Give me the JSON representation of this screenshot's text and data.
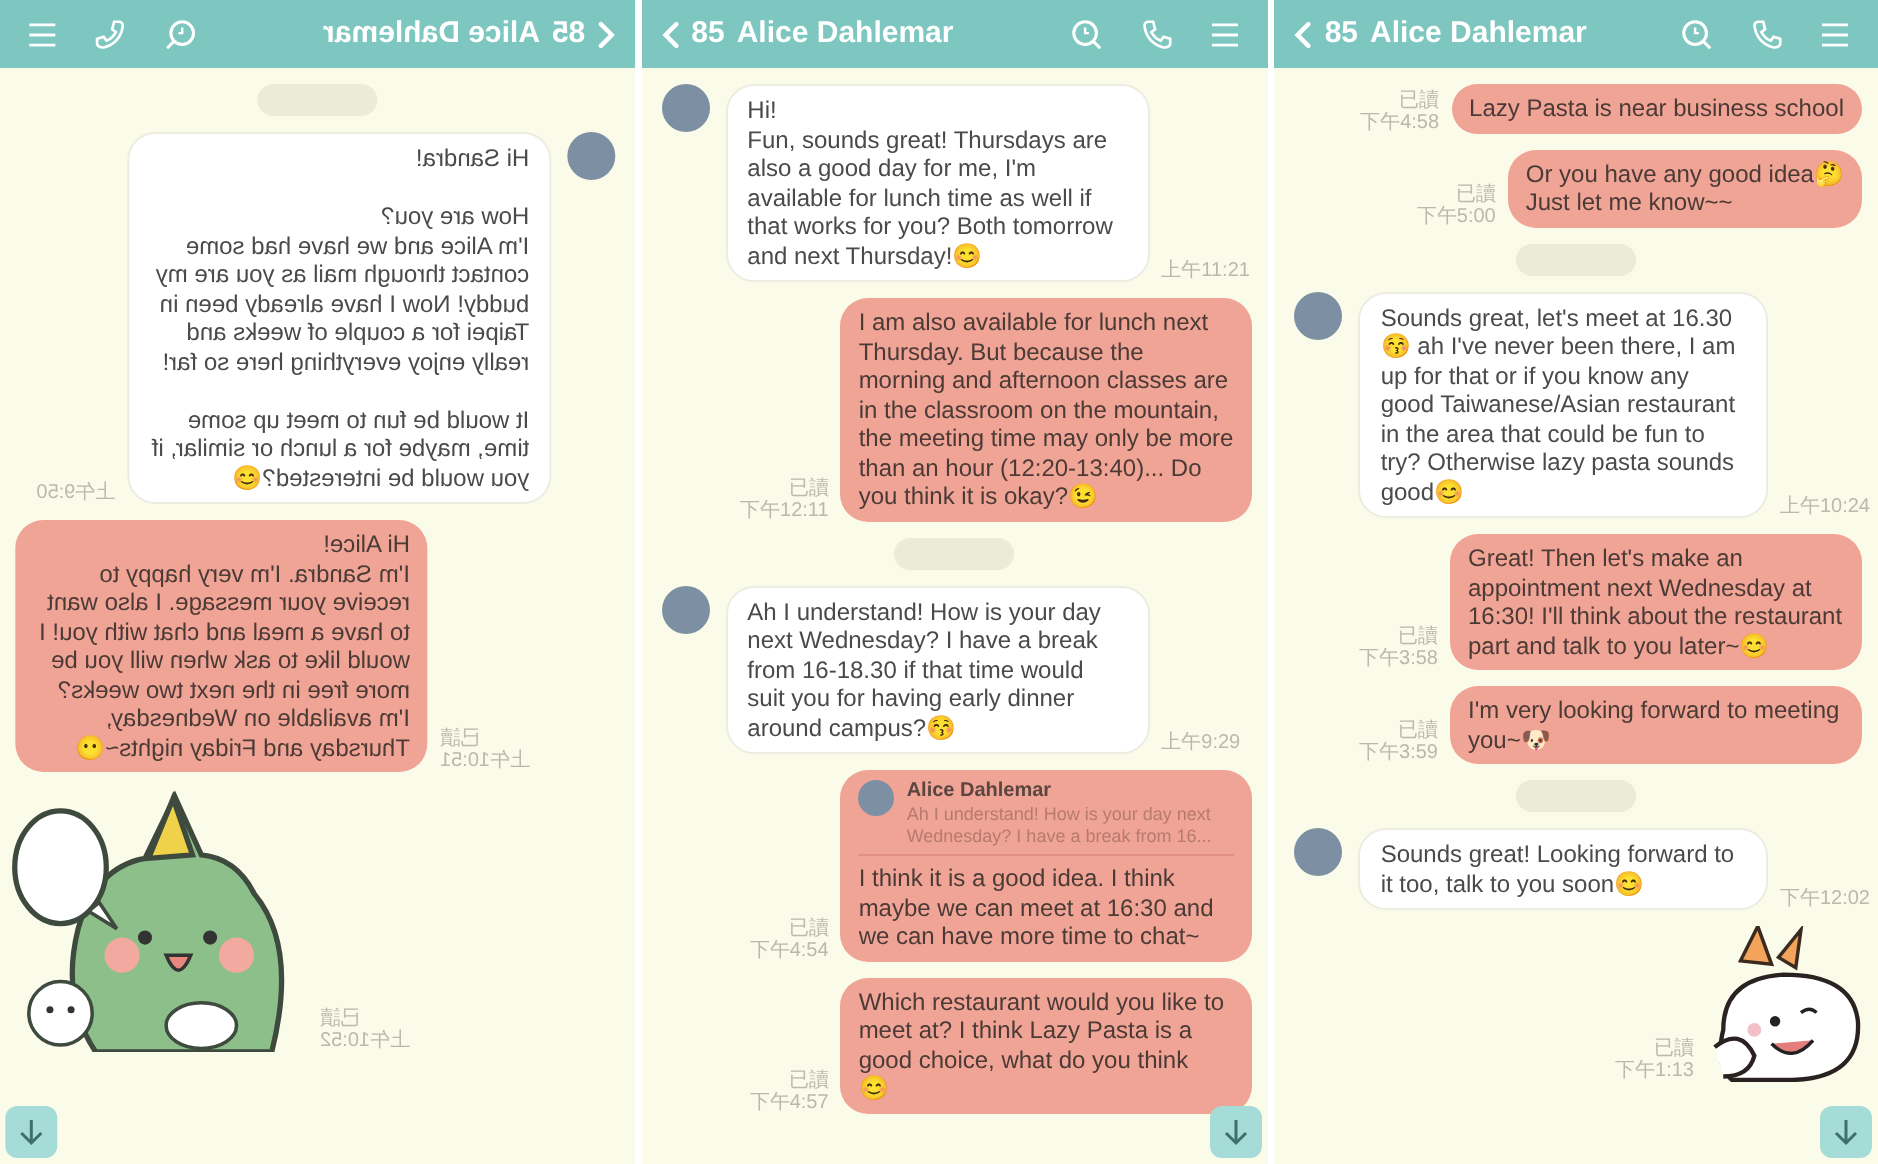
{
  "panels": [
    {
      "mirrored": true,
      "header": {
        "count": "85",
        "title": "Alice Dahlemar"
      },
      "items": [
        {
          "kind": "date"
        },
        {
          "kind": "received",
          "time": "上午9:50",
          "text": "Hi Sandra!\n\nHow are you?\nI'm Alice and we have had some contact through mail as you are my buddy! Now I have already been in Taipei for a couple of weeks and really enjoy everything here so far!\n\nIt would be fun to meet up some time, maybe for a lunch or similar, if you would be interested?😊"
        },
        {
          "kind": "sent",
          "read": "已讀",
          "time": "上午10:51",
          "text": "Hi Alice!\nI'm Sandra. I'm very happy to receive your message. I also want to have a meal and chat with you! I would like to ask when will you be more free in the next two weeks? I'm available on Wednesday, Thursday and Friday nights~😶"
        },
        {
          "kind": "sticker",
          "read": "已讀",
          "time": "上午10:52"
        }
      ]
    },
    {
      "mirrored": false,
      "header": {
        "count": "85",
        "title": "Alice Dahlemar"
      },
      "items": [
        {
          "kind": "received",
          "time": "上午11:21",
          "text": "Hi!\nFun, sounds great! Thursdays are also a good day for me, I'm available for lunch time as well if that works for you? Both tomorrow and next Thursday!😊"
        },
        {
          "kind": "sent",
          "read": "已讀",
          "time": "下午12:11",
          "text": "I am also available for lunch next Thursday. But because the morning and afternoon classes are in the classroom on the mountain, the meeting time may only be more than an hour (12:20-13:40)... Do you think it is okay?😉"
        },
        {
          "kind": "date"
        },
        {
          "kind": "received",
          "time": "上午9:29",
          "text": "Ah I understand! How is your day next Wednesday? I have a break from 16-18.30 if that time would suit you for having early dinner around campus?😚"
        },
        {
          "kind": "sent",
          "read": "已讀",
          "time": "下午4:54",
          "quote": {
            "name": "Alice Dahlemar",
            "text": "Ah I understand! How is your day next Wednesday? I have a break from 16..."
          },
          "text": "I think it is a good idea. I think maybe we can meet at 16:30 and we can have more time to chat~"
        },
        {
          "kind": "sent",
          "read": "已讀",
          "time": "下午4:57",
          "text": "Which restaurant would you like to meet at? I think Lazy Pasta is a good choice, what do you think\n😊"
        }
      ]
    },
    {
      "mirrored": false,
      "header": {
        "count": "85",
        "title": "Alice Dahlemar"
      },
      "items": [
        {
          "kind": "sent",
          "read": "已讀",
          "time": "下午4:58",
          "text": "Lazy Pasta is near business school"
        },
        {
          "kind": "sent",
          "read": "已讀",
          "time": "下午5:00",
          "text": "Or you have any good idea🤔\nJust let me know~~"
        },
        {
          "kind": "date"
        },
        {
          "kind": "received",
          "time": "上午10:24",
          "text": "Sounds great, let's meet at 16.30 😚 ah I've never been there, I am up for that or if you know any good Taiwanese/Asian restaurant in the area that could be fun to try? Otherwise lazy pasta sounds good😊"
        },
        {
          "kind": "sent",
          "read": "已讀",
          "time": "下午3:58",
          "text": "Great! Then let's make an appointment next Wednesday at 16:30! I'll think about the restaurant part and talk to you later~😊"
        },
        {
          "kind": "sent",
          "read": "已讀",
          "time": "下午3:59",
          "text": "I'm very looking forward to meeting you~🐶"
        },
        {
          "kind": "date"
        },
        {
          "kind": "received",
          "time": "下午12:02",
          "text": "Sounds great! Looking forward to it too, talk to you soon😊"
        },
        {
          "kind": "sticker",
          "read": "已讀",
          "time": "下午1:13"
        }
      ]
    }
  ]
}
